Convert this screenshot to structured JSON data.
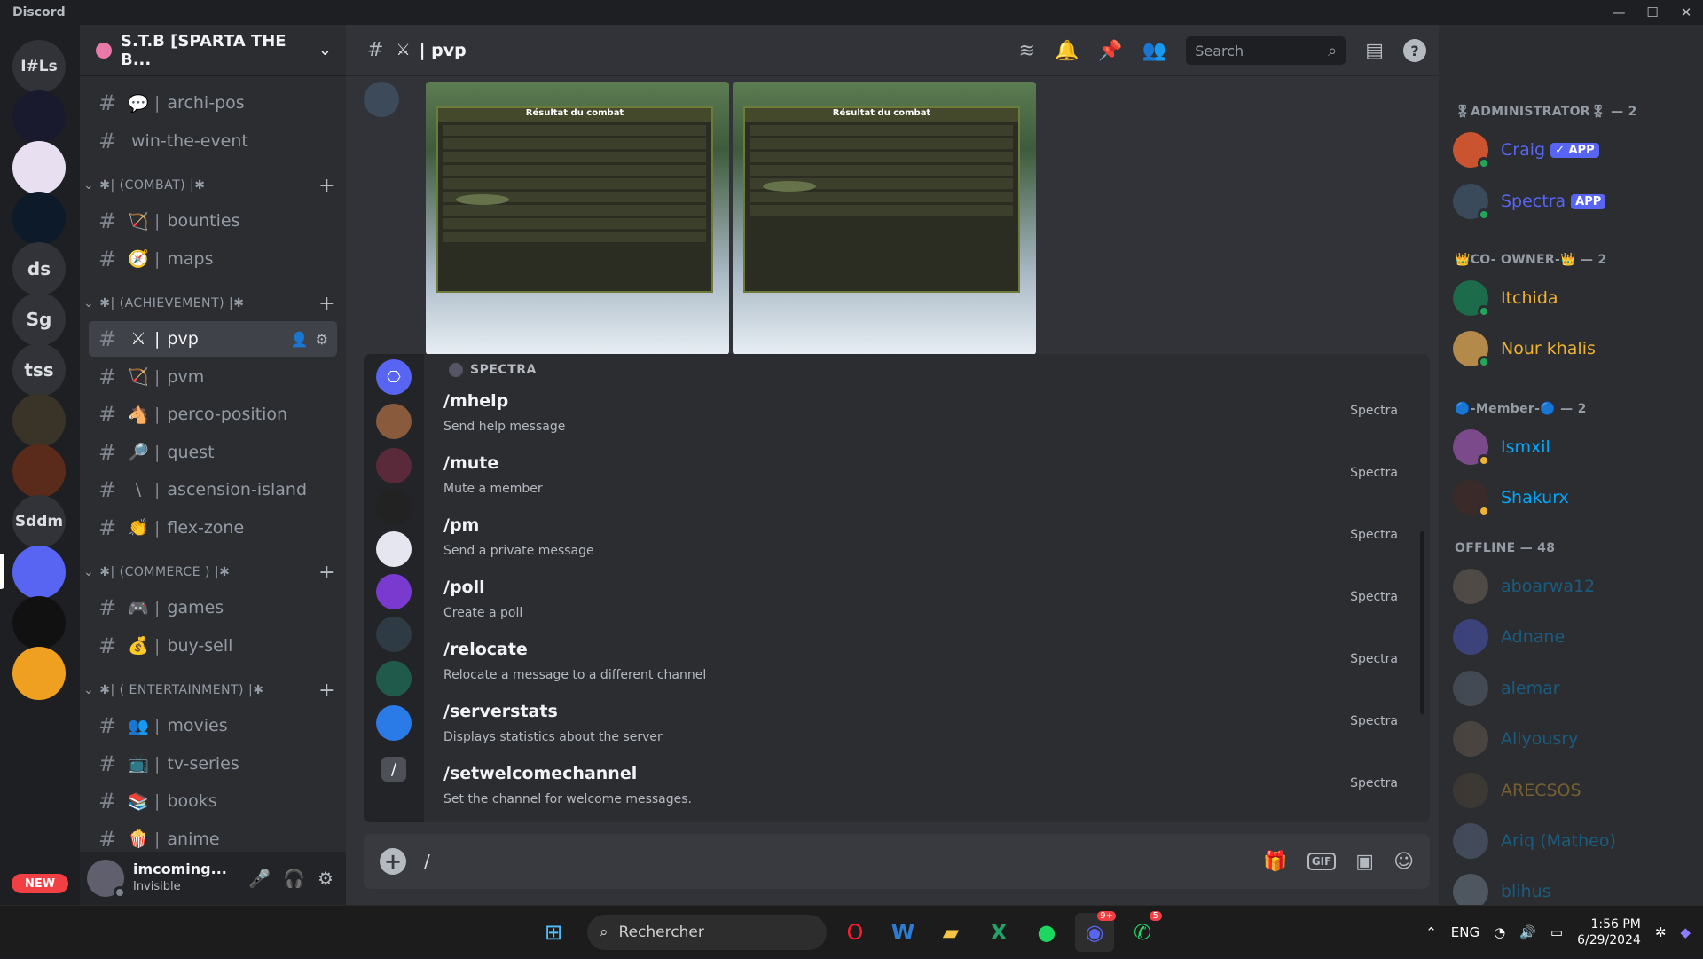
{
  "app": {
    "title": "Discord"
  },
  "window_controls": {
    "minimize": "—",
    "maximize": "☐",
    "close": "✕"
  },
  "guilds": {
    "items": [
      {
        "label": "I#Ls",
        "color": "#313338"
      },
      {
        "label": "",
        "color": "#1a1a2e"
      },
      {
        "label": "",
        "color": "#e8e0f0"
      },
      {
        "label": "",
        "color": "#0c1a2a"
      },
      {
        "label": "ds",
        "color": "#313338"
      },
      {
        "label": "Sg",
        "color": "#313338"
      },
      {
        "label": "tss",
        "color": "#313338"
      },
      {
        "label": "",
        "color": "#3a3328"
      },
      {
        "label": "",
        "color": "#5a2a1a"
      },
      {
        "label": "Sddm",
        "color": "#313338"
      },
      {
        "label": "",
        "color": "#5865f2"
      },
      {
        "label": "",
        "color": "#111111"
      },
      {
        "label": "",
        "color": "#f0a020"
      }
    ],
    "new_badge": "NEW"
  },
  "server": {
    "name": "S.T.B [SPARTA THE B..."
  },
  "channels": [
    {
      "type": "channel",
      "emoji": "💬",
      "name": "archi-pos"
    },
    {
      "type": "channel",
      "emoji": "",
      "name": "win-the-event"
    },
    {
      "type": "category",
      "name": "✱| (COMBAT) |✱"
    },
    {
      "type": "channel",
      "emoji": "🏹",
      "name": "bounties"
    },
    {
      "type": "channel",
      "emoji": "🧭",
      "name": "maps"
    },
    {
      "type": "category",
      "name": "✱| (ACHIEVEMENT) |✱"
    },
    {
      "type": "channel",
      "emoji": "⚔",
      "name": "pvp",
      "active": true
    },
    {
      "type": "channel",
      "emoji": "🏹",
      "name": "pvm"
    },
    {
      "type": "channel",
      "emoji": "🐴",
      "name": "perco-position"
    },
    {
      "type": "channel",
      "emoji": "🔎",
      "name": "quest"
    },
    {
      "type": "channel",
      "emoji": "\\",
      "name": "ascension-island"
    },
    {
      "type": "channel",
      "emoji": "👏",
      "name": "flex-zone"
    },
    {
      "type": "category",
      "name": "✱| (COMMERCE ) |✱"
    },
    {
      "type": "channel",
      "emoji": "🎮",
      "name": "games"
    },
    {
      "type": "channel",
      "emoji": "💰",
      "name": "buy-sell"
    },
    {
      "type": "category",
      "name": "✱| ( ENTERTAINMENT) |✱"
    },
    {
      "type": "channel",
      "emoji": "👥",
      "name": "movies"
    },
    {
      "type": "channel",
      "emoji": "📺",
      "name": "tv-series"
    },
    {
      "type": "channel",
      "emoji": "📚",
      "name": "books"
    },
    {
      "type": "channel",
      "emoji": "🍿",
      "name": "anime"
    }
  ],
  "user": {
    "name": "imcoming...",
    "status": "Invisible"
  },
  "header": {
    "channel_emoji": "⚔",
    "channel_name": "| pvp",
    "search_placeholder": "Search"
  },
  "autocomplete": {
    "section": "SPECTRA",
    "commands": [
      {
        "name": "/mhelp",
        "desc": "Send help message",
        "source": "Spectra"
      },
      {
        "name": "/mute",
        "desc": "Mute a member",
        "source": "Spectra"
      },
      {
        "name": "/pm",
        "desc": "Send a private message",
        "source": "Spectra"
      },
      {
        "name": "/poll",
        "desc": "Create a poll",
        "source": "Spectra"
      },
      {
        "name": "/relocate",
        "desc": "Relocate a message to a different channel",
        "source": "Spectra"
      },
      {
        "name": "/serverstats",
        "desc": "Displays statistics about the server",
        "source": "Spectra"
      },
      {
        "name": "/setwelcomechannel",
        "desc": "Set the channel for welcome messages.",
        "source": "Spectra"
      }
    ]
  },
  "screenshot_titles": [
    "Résultat du combat",
    "Résultat du combat"
  ],
  "composer": {
    "value": "/"
  },
  "members": {
    "groups": [
      {
        "title": "🎖ADMINISTRATOR🎖 — 2",
        "items": [
          {
            "name": "Craig",
            "color": "#5865f2",
            "badge": "✓ APP",
            "status": "#23a55a"
          },
          {
            "name": "Spectra",
            "color": "#5865f2",
            "badge": "APP",
            "status": "#23a55a"
          }
        ]
      },
      {
        "title": "👑CO- OWNER-👑 — 2",
        "items": [
          {
            "name": "Itchida",
            "color": "#f0b232",
            "badge": "",
            "status": "#23a55a"
          },
          {
            "name": "Nour khalis",
            "color": "#f0b232",
            "badge": "",
            "status": "#23a55a"
          }
        ]
      },
      {
        "title": "🔵-Member-🔵 — 2",
        "items": [
          {
            "name": "Ismxil",
            "color": "#00a8fc",
            "badge": "",
            "status": "#f0b232"
          },
          {
            "name": "Shakurx",
            "color": "#00a8fc",
            "badge": "",
            "status": "#f0b232"
          }
        ]
      },
      {
        "title": "OFFLINE — 48",
        "items": [
          {
            "name": "aboarwa12",
            "color": "#00a8fc"
          },
          {
            "name": "Adnane",
            "color": "#00a8fc"
          },
          {
            "name": "alemar",
            "color": "#00a8fc"
          },
          {
            "name": "Aliyousry",
            "color": "#00a8fc"
          },
          {
            "name": "ARECSOS",
            "color": "#f0b232"
          },
          {
            "name": "Ariq (Matheo)",
            "color": "#00a8fc"
          },
          {
            "name": "blihus",
            "color": "#00a8fc"
          }
        ]
      }
    ]
  },
  "taskbar": {
    "search_placeholder": "Rechercher",
    "language": "ENG",
    "time": "1:56 PM",
    "date": "6/29/2024",
    "discord_badge": "9+",
    "whatsapp_badge": "5"
  }
}
